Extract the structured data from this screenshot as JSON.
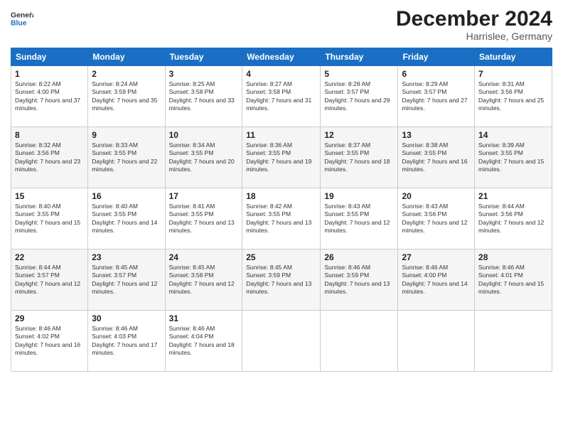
{
  "header": {
    "logo_general": "General",
    "logo_blue": "Blue",
    "month_title": "December 2024",
    "location": "Harrislee, Germany"
  },
  "days_of_week": [
    "Sunday",
    "Monday",
    "Tuesday",
    "Wednesday",
    "Thursday",
    "Friday",
    "Saturday"
  ],
  "weeks": [
    [
      {
        "day": "1",
        "sunrise": "8:22 AM",
        "sunset": "4:00 PM",
        "daylight": "7 hours and 37 minutes."
      },
      {
        "day": "2",
        "sunrise": "8:24 AM",
        "sunset": "3:59 PM",
        "daylight": "7 hours and 35 minutes."
      },
      {
        "day": "3",
        "sunrise": "8:25 AM",
        "sunset": "3:58 PM",
        "daylight": "7 hours and 33 minutes."
      },
      {
        "day": "4",
        "sunrise": "8:27 AM",
        "sunset": "3:58 PM",
        "daylight": "7 hours and 31 minutes."
      },
      {
        "day": "5",
        "sunrise": "8:28 AM",
        "sunset": "3:57 PM",
        "daylight": "7 hours and 29 minutes."
      },
      {
        "day": "6",
        "sunrise": "8:29 AM",
        "sunset": "3:57 PM",
        "daylight": "7 hours and 27 minutes."
      },
      {
        "day": "7",
        "sunrise": "8:31 AM",
        "sunset": "3:56 PM",
        "daylight": "7 hours and 25 minutes."
      }
    ],
    [
      {
        "day": "8",
        "sunrise": "8:32 AM",
        "sunset": "3:56 PM",
        "daylight": "7 hours and 23 minutes."
      },
      {
        "day": "9",
        "sunrise": "8:33 AM",
        "sunset": "3:55 PM",
        "daylight": "7 hours and 22 minutes."
      },
      {
        "day": "10",
        "sunrise": "8:34 AM",
        "sunset": "3:55 PM",
        "daylight": "7 hours and 20 minutes."
      },
      {
        "day": "11",
        "sunrise": "8:36 AM",
        "sunset": "3:55 PM",
        "daylight": "7 hours and 19 minutes."
      },
      {
        "day": "12",
        "sunrise": "8:37 AM",
        "sunset": "3:55 PM",
        "daylight": "7 hours and 18 minutes."
      },
      {
        "day": "13",
        "sunrise": "8:38 AM",
        "sunset": "3:55 PM",
        "daylight": "7 hours and 16 minutes."
      },
      {
        "day": "14",
        "sunrise": "8:39 AM",
        "sunset": "3:55 PM",
        "daylight": "7 hours and 15 minutes."
      }
    ],
    [
      {
        "day": "15",
        "sunrise": "8:40 AM",
        "sunset": "3:55 PM",
        "daylight": "7 hours and 15 minutes."
      },
      {
        "day": "16",
        "sunrise": "8:40 AM",
        "sunset": "3:55 PM",
        "daylight": "7 hours and 14 minutes."
      },
      {
        "day": "17",
        "sunrise": "8:41 AM",
        "sunset": "3:55 PM",
        "daylight": "7 hours and 13 minutes."
      },
      {
        "day": "18",
        "sunrise": "8:42 AM",
        "sunset": "3:55 PM",
        "daylight": "7 hours and 13 minutes."
      },
      {
        "day": "19",
        "sunrise": "8:43 AM",
        "sunset": "3:55 PM",
        "daylight": "7 hours and 12 minutes."
      },
      {
        "day": "20",
        "sunrise": "8:43 AM",
        "sunset": "3:56 PM",
        "daylight": "7 hours and 12 minutes."
      },
      {
        "day": "21",
        "sunrise": "8:44 AM",
        "sunset": "3:56 PM",
        "daylight": "7 hours and 12 minutes."
      }
    ],
    [
      {
        "day": "22",
        "sunrise": "8:44 AM",
        "sunset": "3:57 PM",
        "daylight": "7 hours and 12 minutes."
      },
      {
        "day": "23",
        "sunrise": "8:45 AM",
        "sunset": "3:57 PM",
        "daylight": "7 hours and 12 minutes."
      },
      {
        "day": "24",
        "sunrise": "8:45 AM",
        "sunset": "3:58 PM",
        "daylight": "7 hours and 12 minutes."
      },
      {
        "day": "25",
        "sunrise": "8:45 AM",
        "sunset": "3:59 PM",
        "daylight": "7 hours and 13 minutes."
      },
      {
        "day": "26",
        "sunrise": "8:46 AM",
        "sunset": "3:59 PM",
        "daylight": "7 hours and 13 minutes."
      },
      {
        "day": "27",
        "sunrise": "8:46 AM",
        "sunset": "4:00 PM",
        "daylight": "7 hours and 14 minutes."
      },
      {
        "day": "28",
        "sunrise": "8:46 AM",
        "sunset": "4:01 PM",
        "daylight": "7 hours and 15 minutes."
      }
    ],
    [
      {
        "day": "29",
        "sunrise": "8:46 AM",
        "sunset": "4:02 PM",
        "daylight": "7 hours and 16 minutes."
      },
      {
        "day": "30",
        "sunrise": "8:46 AM",
        "sunset": "4:03 PM",
        "daylight": "7 hours and 17 minutes."
      },
      {
        "day": "31",
        "sunrise": "8:46 AM",
        "sunset": "4:04 PM",
        "daylight": "7 hours and 18 minutes."
      },
      null,
      null,
      null,
      null
    ]
  ]
}
